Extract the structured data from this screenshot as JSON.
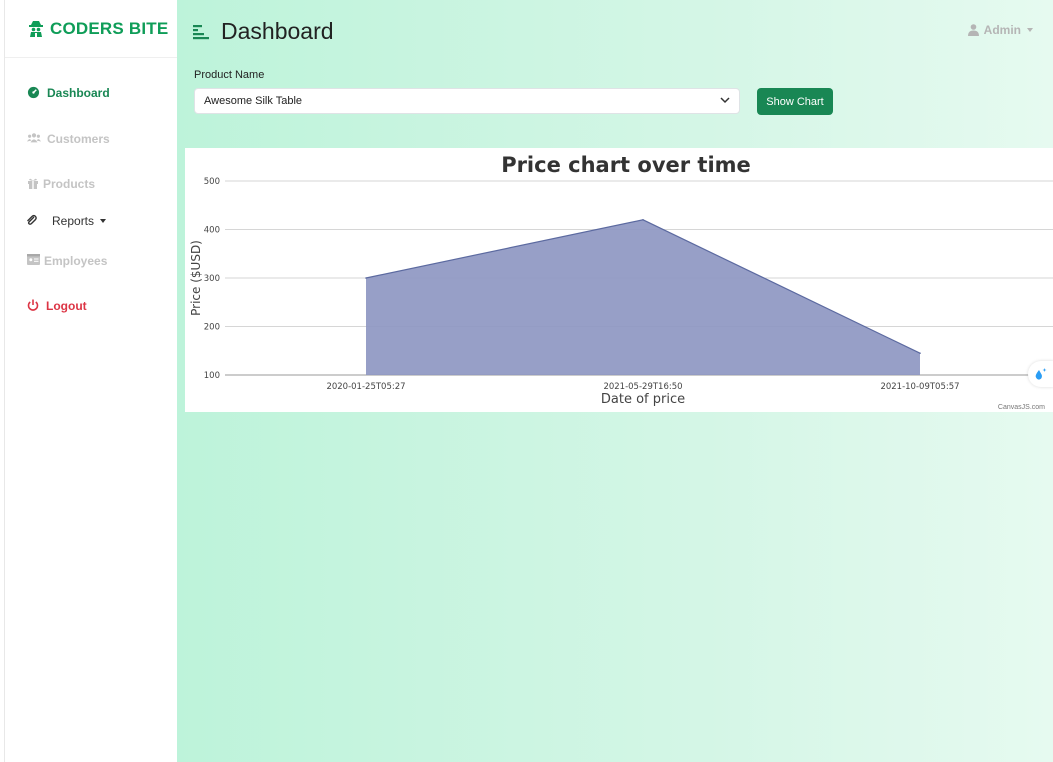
{
  "brand": {
    "name": "CODERS BITE",
    "icon": "spy-icon",
    "color": "#0f9d58"
  },
  "sidebar": {
    "items": [
      {
        "label": "Dashboard",
        "icon": "tachometer-icon",
        "active": true
      },
      {
        "label": "Customers",
        "icon": "users-icon"
      },
      {
        "label": "Products",
        "icon": "gift-icon"
      },
      {
        "label": "Reports",
        "icon": "paperclip-icon",
        "dropdown": true
      },
      {
        "label": "Employees",
        "icon": "id-card-icon"
      },
      {
        "label": "Logout",
        "icon": "power-icon"
      }
    ]
  },
  "header": {
    "title": "Dashboard",
    "menu_icon": "align-left-icon",
    "user": "Admin",
    "user_icon": "user-icon"
  },
  "form": {
    "label": "Product Name",
    "selected": "Awesome Silk Table",
    "button": "Show Chart"
  },
  "colors": {
    "accent": "#198754",
    "danger": "#dc3545",
    "area_fill": "#8e97c2",
    "area_line": "#5c6aa0"
  },
  "chart_data": {
    "type": "area",
    "title": "Price chart over time",
    "xlabel": "Date of price",
    "ylabel": "Price ($USD)",
    "x": [
      "2020-01-25T05:27",
      "2021-05-29T16:50",
      "2021-10-09T05:57"
    ],
    "values": [
      300,
      420,
      145
    ],
    "ylim": [
      100,
      500
    ],
    "yticks": [
      100,
      200,
      300,
      400,
      500
    ],
    "grid": true,
    "credit": "CanvasJS.com"
  }
}
